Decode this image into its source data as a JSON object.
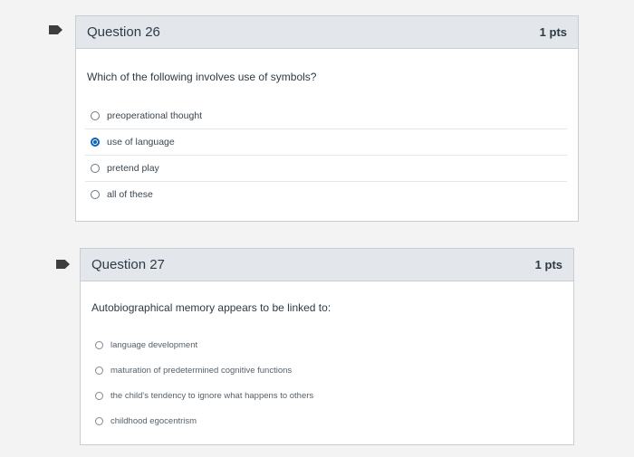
{
  "questions": [
    {
      "title": "Question 26",
      "points": "1 pts",
      "text": "Which of the following involves use of symbols?",
      "answers": [
        {
          "label": "preoperational thought",
          "selected": false
        },
        {
          "label": "use of language",
          "selected": true
        },
        {
          "label": "pretend play",
          "selected": false
        },
        {
          "label": "all of these",
          "selected": false
        }
      ]
    },
    {
      "title": "Question 27",
      "points": "1 pts",
      "text": "Autobiographical memory appears to be linked to:",
      "answers": [
        {
          "label": "language development",
          "selected": false
        },
        {
          "label": "maturation of predetermined cognitive functions",
          "selected": false
        },
        {
          "label": "the child's tendency to ignore what happens to others",
          "selected": false
        },
        {
          "label": "childhood egocentrism",
          "selected": false
        }
      ]
    }
  ],
  "colors": {
    "accent": "#0b63b6",
    "header_bg": "#e3e7eb",
    "flag": "#3d3d3d"
  },
  "icons": {
    "flag": "flag-icon",
    "radio": "radio-icon"
  }
}
